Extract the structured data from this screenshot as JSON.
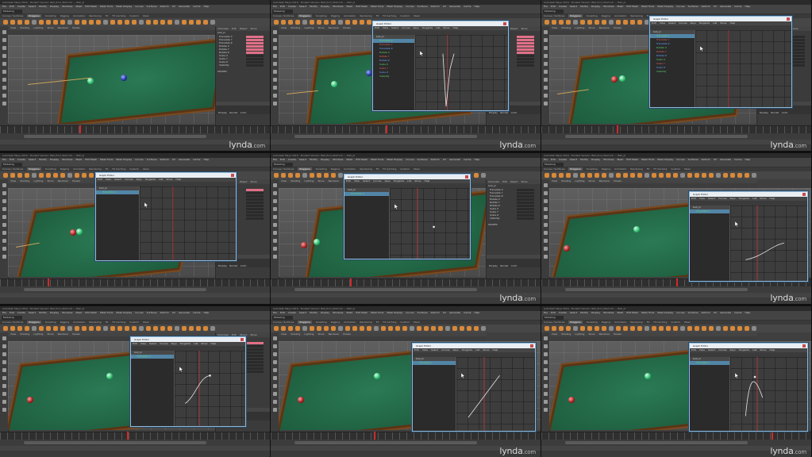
{
  "app": {
    "title": "Autodesk Maya 2016 - Student Version: Ball_Pool_Start.mb --- Ball_pl",
    "workspace_mode": "Modeling",
    "menus": [
      "File",
      "Edit",
      "Create",
      "Select",
      "Modify",
      "Display",
      "Windows",
      "Mesh",
      "Edit Mesh",
      "Mesh Tools",
      "Mesh Display",
      "Curves",
      "Surfaces",
      "Deform",
      "UV",
      "Generate",
      "Cache",
      "Help"
    ],
    "shelf_tabs": [
      "Curves / Surfaces",
      "Polygons",
      "Sculpting",
      "Rigging",
      "Animation",
      "Rendering",
      "FX",
      "FX Caching",
      "Custom",
      "XGen"
    ],
    "panel_menus": [
      "View",
      "Shading",
      "Lighting",
      "Show",
      "Renderer",
      "Panels"
    ]
  },
  "channel_box": {
    "tabs": [
      "Channels",
      "Edit",
      "Object",
      "Show"
    ],
    "object_name": "ball_pl",
    "attributes": [
      "Translate X",
      "Translate Y",
      "Translate Z",
      "Rotate X",
      "Rotate Y",
      "Rotate Z",
      "Scale X",
      "Scale Y",
      "Scale Z",
      "Visibility"
    ],
    "shapes_label": "SHAPES",
    "layer_tabs": [
      "Display",
      "Render",
      "Anim"
    ]
  },
  "graph_editor": {
    "title": "Graph Editor",
    "menus": [
      "Edit",
      "View",
      "Select",
      "Curves",
      "Keys",
      "Tangents",
      "List",
      "Show",
      "Help"
    ],
    "outliner_rows": [
      "ball_pl",
      "Translate X",
      "Translate Y",
      "Translate Z",
      "Rotate X",
      "Rotate Y",
      "Rotate Z",
      "Scale X",
      "Scale Y",
      "Scale Z",
      "Visibility"
    ],
    "selected_object": "ball_pl",
    "selected_channel": "Translate X"
  },
  "watermark": {
    "brand": "lynda",
    "suffix": ".com"
  }
}
